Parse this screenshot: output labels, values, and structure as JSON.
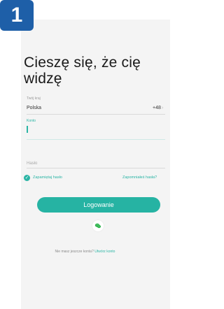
{
  "badge": {
    "number": "1",
    "color": "#1e5fa8"
  },
  "title": "Cieszę się, że cię widzę",
  "region": {
    "label": "Twój kraj",
    "country": "Polska",
    "code": "+48",
    "chevron": "›"
  },
  "account": {
    "label": "Konto",
    "value": ""
  },
  "password": {
    "placeholder": "Hasło",
    "value": ""
  },
  "remember": {
    "label": "Zapamiętaj hasło",
    "checked": true
  },
  "forgot_label": "Zapomniałeś hasła?",
  "login_label": "Logowanie",
  "social": {
    "icon": "wechat-icon"
  },
  "signup": {
    "prompt": "Nie masz jeszcze konta?",
    "link": "Utwórz konto"
  },
  "colors": {
    "accent": "#26b3a3",
    "badge": "#1e5fa8"
  }
}
